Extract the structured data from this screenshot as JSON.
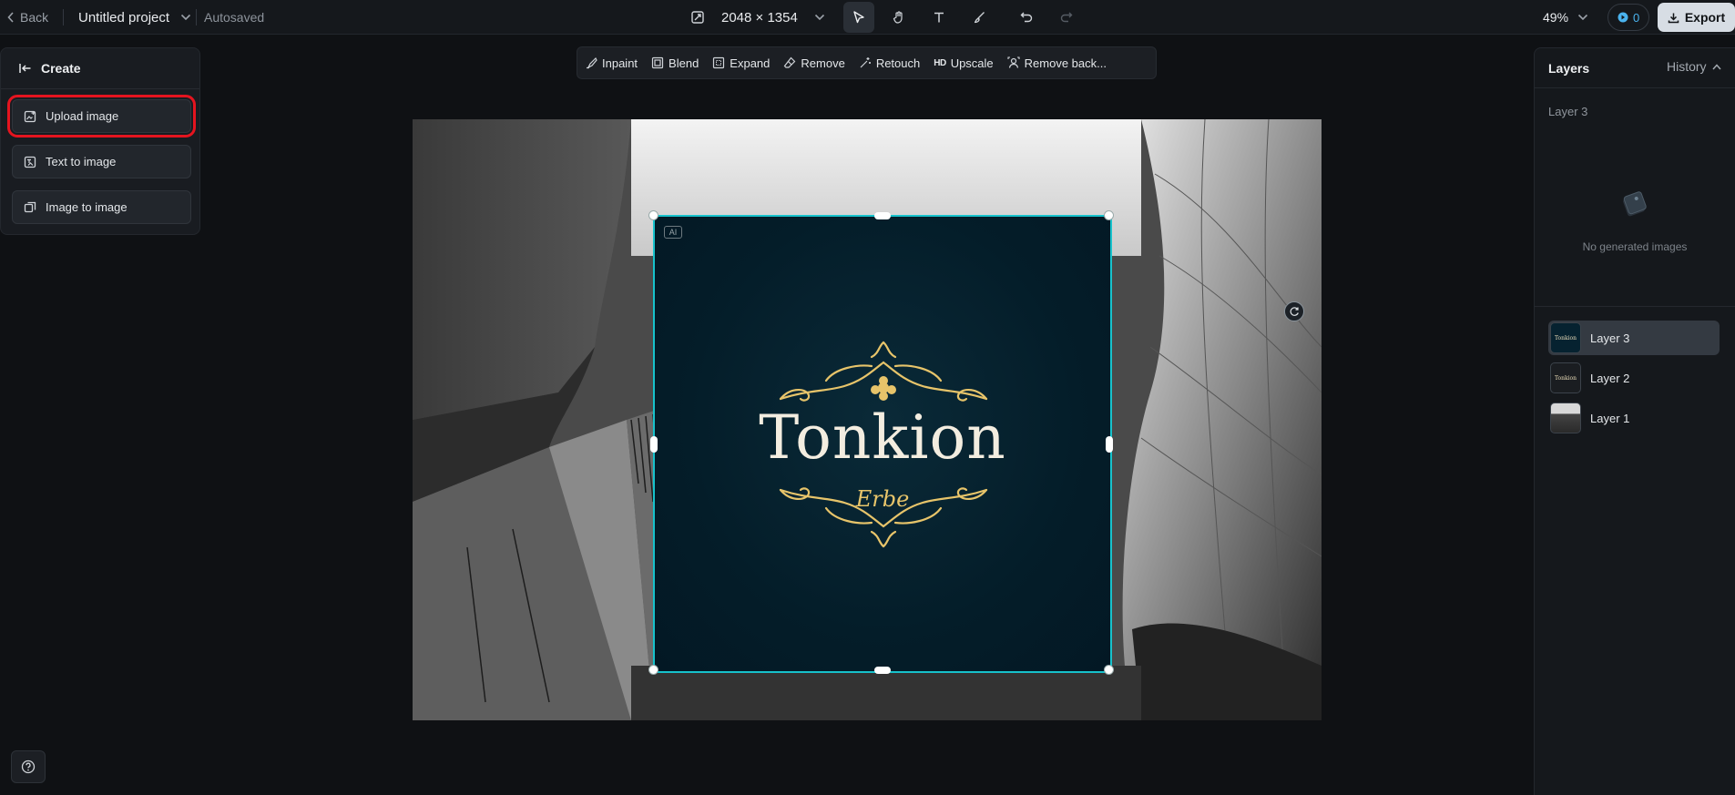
{
  "topbar": {
    "back_label": "Back",
    "project_name": "Untitled project",
    "save_status": "Autosaved",
    "canvas_size": "2048 × 1354",
    "zoom": "49%",
    "credits": "0",
    "export_label": "Export"
  },
  "tools": [
    "select-tool",
    "hand-tool",
    "text-tool",
    "brush-tool",
    "undo",
    "redo"
  ],
  "left_panel": {
    "header": "Create",
    "buttons": [
      {
        "label": "Upload image"
      },
      {
        "label": "Text to image"
      },
      {
        "label": "Image to image"
      }
    ]
  },
  "edit_toolbar": {
    "items": [
      "Inpaint",
      "Blend",
      "Expand",
      "Remove",
      "Retouch",
      "Upscale",
      "Remove back..."
    ],
    "hd_badge": "HD"
  },
  "canvas": {
    "ai_badge": "AI",
    "logo_title": "Tonkion",
    "logo_script": "Erbe"
  },
  "right_panel": {
    "title": "Layers",
    "history_label": "History",
    "current_layer": "Layer 3",
    "empty_text": "No generated images",
    "layers": [
      "Layer 3",
      "Layer 2",
      "Layer 1"
    ],
    "thumb_text": "Tonkion"
  },
  "colors": {
    "accent_cyan": "#17c2cc",
    "highlight_red": "#e5141f",
    "gold": "#e7c46a",
    "art_bg": "#041d29"
  }
}
